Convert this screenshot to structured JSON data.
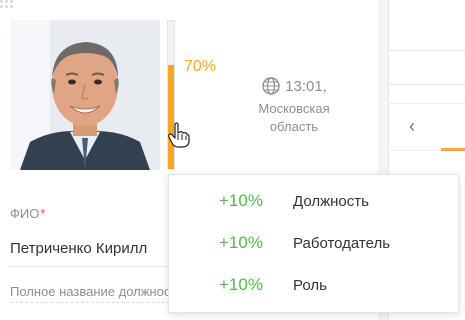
{
  "profile": {
    "photo_alt": "",
    "completeness_percent": 70,
    "completeness_label": "70%",
    "time": "13:01,",
    "region_line1": "Московская",
    "region_line2": "область"
  },
  "fields": {
    "fio_label": "ФИО",
    "fio_required_mark": "*",
    "fio_value": "Петриченко Кирилл",
    "full_name_placeholder": "Полное название должности"
  },
  "tooltip": {
    "rows": [
      {
        "percent": "+10%",
        "label": "Должность"
      },
      {
        "percent": "+10%",
        "label": "Работодатель"
      },
      {
        "percent": "+10%",
        "label": "Роль"
      }
    ]
  },
  "right_panel": {
    "back_icon": "chevron-left-icon"
  },
  "colors": {
    "accent_orange": "#f5a623",
    "positive_green": "#55b949",
    "required_red": "#e4453a",
    "muted_text": "#8a8f98"
  }
}
